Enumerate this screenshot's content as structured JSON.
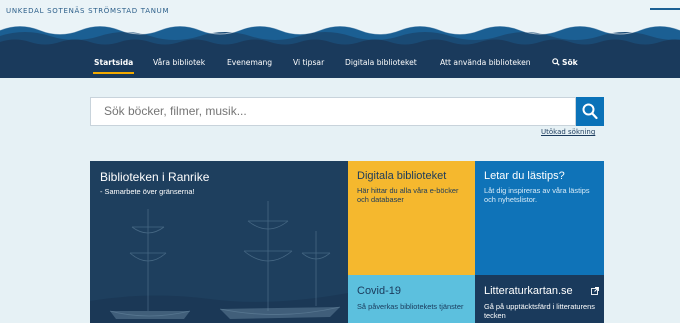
{
  "header": {
    "municipalities": "UNKEDAL SOTENÄS STRÖMSTAD TANUM"
  },
  "nav": {
    "items": [
      {
        "label": "Startsida"
      },
      {
        "label": "Våra bibliotek"
      },
      {
        "label": "Evenemang"
      },
      {
        "label": "Vi tipsar"
      },
      {
        "label": "Digitala biblioteket"
      },
      {
        "label": "Att använda biblioteken"
      }
    ],
    "search_label": "Sök",
    "active_item": "Startsida"
  },
  "search": {
    "placeholder": "Sök böcker, filmer, musik...",
    "advanced_link": "Utökad sökning"
  },
  "tiles": {
    "main": {
      "title": "Biblioteken i Ranrike",
      "subtitle": "- Samarbete över gränserna!"
    },
    "digital": {
      "title": "Digitala biblioteket",
      "subtitle": "Här hittar du alla våra e-böcker och databaser"
    },
    "tips": {
      "title": "Letar du lästips?",
      "subtitle": "Låt dig inspireras av våra lästips och nyhetslistor."
    },
    "covid": {
      "title": "Covid-19",
      "subtitle": "Så påverkas bibliotekets tjänster"
    },
    "map": {
      "title": "Litteraturkartan.se",
      "subtitle": "Gå på upptäcktsfärd i litteraturens tecken"
    }
  },
  "colors": {
    "nav_bg": "#1a3a5c",
    "accent": "#f2a900",
    "search_button": "#0a72b8",
    "tile_yellow": "#f5b82e",
    "tile_blue": "#0f73b8",
    "tile_cyan": "#5cc0de"
  },
  "icons": {
    "search": "search-icon",
    "external": "external-link-icon"
  }
}
